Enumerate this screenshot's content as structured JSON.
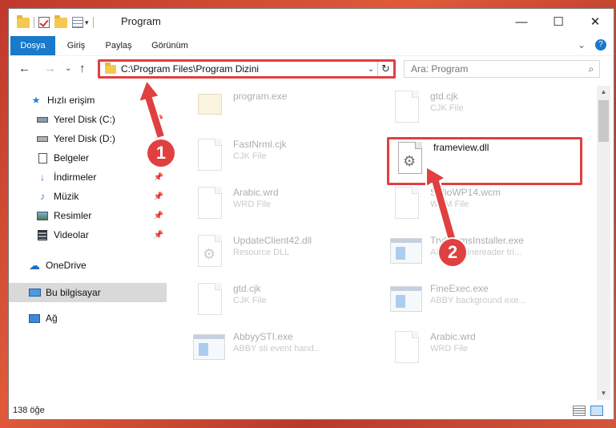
{
  "window": {
    "title": "Program",
    "controls": {
      "minimize": "—",
      "maximize": "☐",
      "close": "✕"
    }
  },
  "ribbon": {
    "tabs": [
      "Dosya",
      "Giriş",
      "Paylaş",
      "Görünüm"
    ],
    "expand": "⌄",
    "help": "?"
  },
  "address": {
    "back": "←",
    "forward": "→",
    "recent": "⌄",
    "up": "↑",
    "path": "C:\\Program Files\\Program Dizini",
    "dropdown": "⌄",
    "refresh": "↻"
  },
  "search": {
    "placeholder": "Ara: Program",
    "icon": "search-icon"
  },
  "sidebar": {
    "items": [
      {
        "label": "Hızlı erişim",
        "icon": "star-icon",
        "pinned": false
      },
      {
        "label": "Yerel Disk (C:)",
        "icon": "drive-icon",
        "pinned": true
      },
      {
        "label": "Yerel Disk (D:)",
        "icon": "drive-icon",
        "pinned": true
      },
      {
        "label": "Belgeler",
        "icon": "documents-icon",
        "pinned": true
      },
      {
        "label": "İndirmeler",
        "icon": "download-icon",
        "pinned": true
      },
      {
        "label": "Müzik",
        "icon": "music-icon",
        "pinned": true
      },
      {
        "label": "Resimler",
        "icon": "pictures-icon",
        "pinned": true
      },
      {
        "label": "Videolar",
        "icon": "video-icon",
        "pinned": true
      },
      {
        "label": "OneDrive",
        "icon": "cloud-icon",
        "pinned": false
      },
      {
        "label": "Bu bilgisayar",
        "icon": "computer-icon",
        "pinned": false,
        "selected": true
      },
      {
        "label": "Ağ",
        "icon": "network-icon",
        "pinned": false
      }
    ]
  },
  "files": [
    {
      "name": "program.exe",
      "type": "",
      "icon": "package-icon"
    },
    {
      "name": "gtd.cjk",
      "type": "CJK File",
      "icon": "document-icon"
    },
    {
      "name": "FastNrml.cjk",
      "type": "CJK File",
      "icon": "document-icon"
    },
    {
      "name": "frameview.dll",
      "type": "",
      "icon": "gear-file-icon"
    },
    {
      "name": "Arabic.wrd",
      "type": "WRD File",
      "icon": "document-icon"
    },
    {
      "name": "StdioWP14.wcm",
      "type": "WCM File",
      "icon": "document-icon"
    },
    {
      "name": "UpdateClient42.dll",
      "type": "Resource DLL",
      "icon": "gear-file-icon"
    },
    {
      "name": "TryGermsInstaller.exe",
      "type": "ABBYY Finereader tri...",
      "icon": "exe-icon"
    },
    {
      "name": "gtd.cjk",
      "type": "CJK File",
      "icon": "document-icon"
    },
    {
      "name": "FineExec.exe",
      "type": "ABBY background exe...",
      "icon": "exe-icon"
    },
    {
      "name": "AbbyySTI.exe",
      "type": "ABBY sti event hand...",
      "icon": "exe-icon"
    },
    {
      "name": "Arabic.wrd",
      "type": "WRD File",
      "icon": "document-icon"
    }
  ],
  "status": {
    "count": "138 öğe"
  },
  "callouts": {
    "one": "1",
    "two": "2"
  },
  "colors": {
    "accent": "#1979ca",
    "highlight": "#e04040"
  }
}
